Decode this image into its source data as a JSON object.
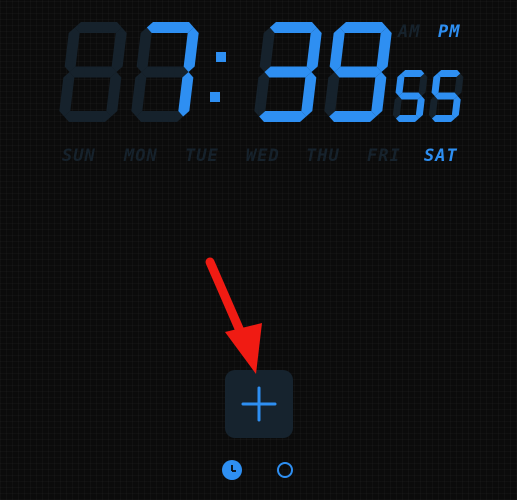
{
  "colors": {
    "active": "#2e8ff2",
    "inactive": "#16222c",
    "button_bg": "#16232e",
    "arrow": "#f01b13"
  },
  "clock": {
    "hours": "07",
    "separator": ":",
    "minutes": "39",
    "seconds": "55",
    "ghost_digit": "8",
    "am_label": "AM",
    "pm_label": "PM",
    "active_period": "PM"
  },
  "weekdays": {
    "items": [
      "SUN",
      "MON",
      "TUE",
      "WED",
      "THU",
      "FRI",
      "SAT"
    ],
    "active": "SAT"
  },
  "add_button": {
    "icon": "plus-icon"
  },
  "pager": {
    "pages": [
      {
        "icon": "clock-icon",
        "active": true
      },
      {
        "icon": "circle-icon",
        "active": false
      }
    ]
  },
  "annotation": {
    "icon": "red-arrow-icon"
  }
}
